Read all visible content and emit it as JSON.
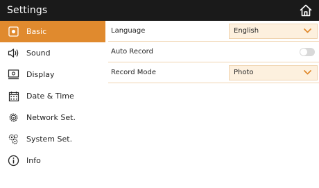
{
  "header": {
    "title": "Settings",
    "home_icon": "home-icon"
  },
  "sidebar": {
    "items": [
      {
        "label": "Basic",
        "icon": "basic-icon",
        "active": true
      },
      {
        "label": "Sound",
        "icon": "speaker-icon",
        "active": false
      },
      {
        "label": "Display",
        "icon": "monitor-icon",
        "active": false
      },
      {
        "label": "Date & Time",
        "icon": "calendar-icon",
        "active": false
      },
      {
        "label": "Network Set.",
        "icon": "network-gear-icon",
        "active": false
      },
      {
        "label": "System Set.",
        "icon": "system-gears-icon",
        "active": false
      },
      {
        "label": "Info",
        "icon": "info-icon",
        "active": false
      }
    ]
  },
  "settings": {
    "language": {
      "label": "Language",
      "value": "English"
    },
    "auto_record": {
      "label": "Auto Record",
      "enabled": false
    },
    "record_mode": {
      "label": "Record Mode",
      "value": "Photo"
    }
  },
  "colors": {
    "accent": "#e08a2e",
    "select_bg": "#fdf0de",
    "topbar": "#1a1a1a"
  }
}
